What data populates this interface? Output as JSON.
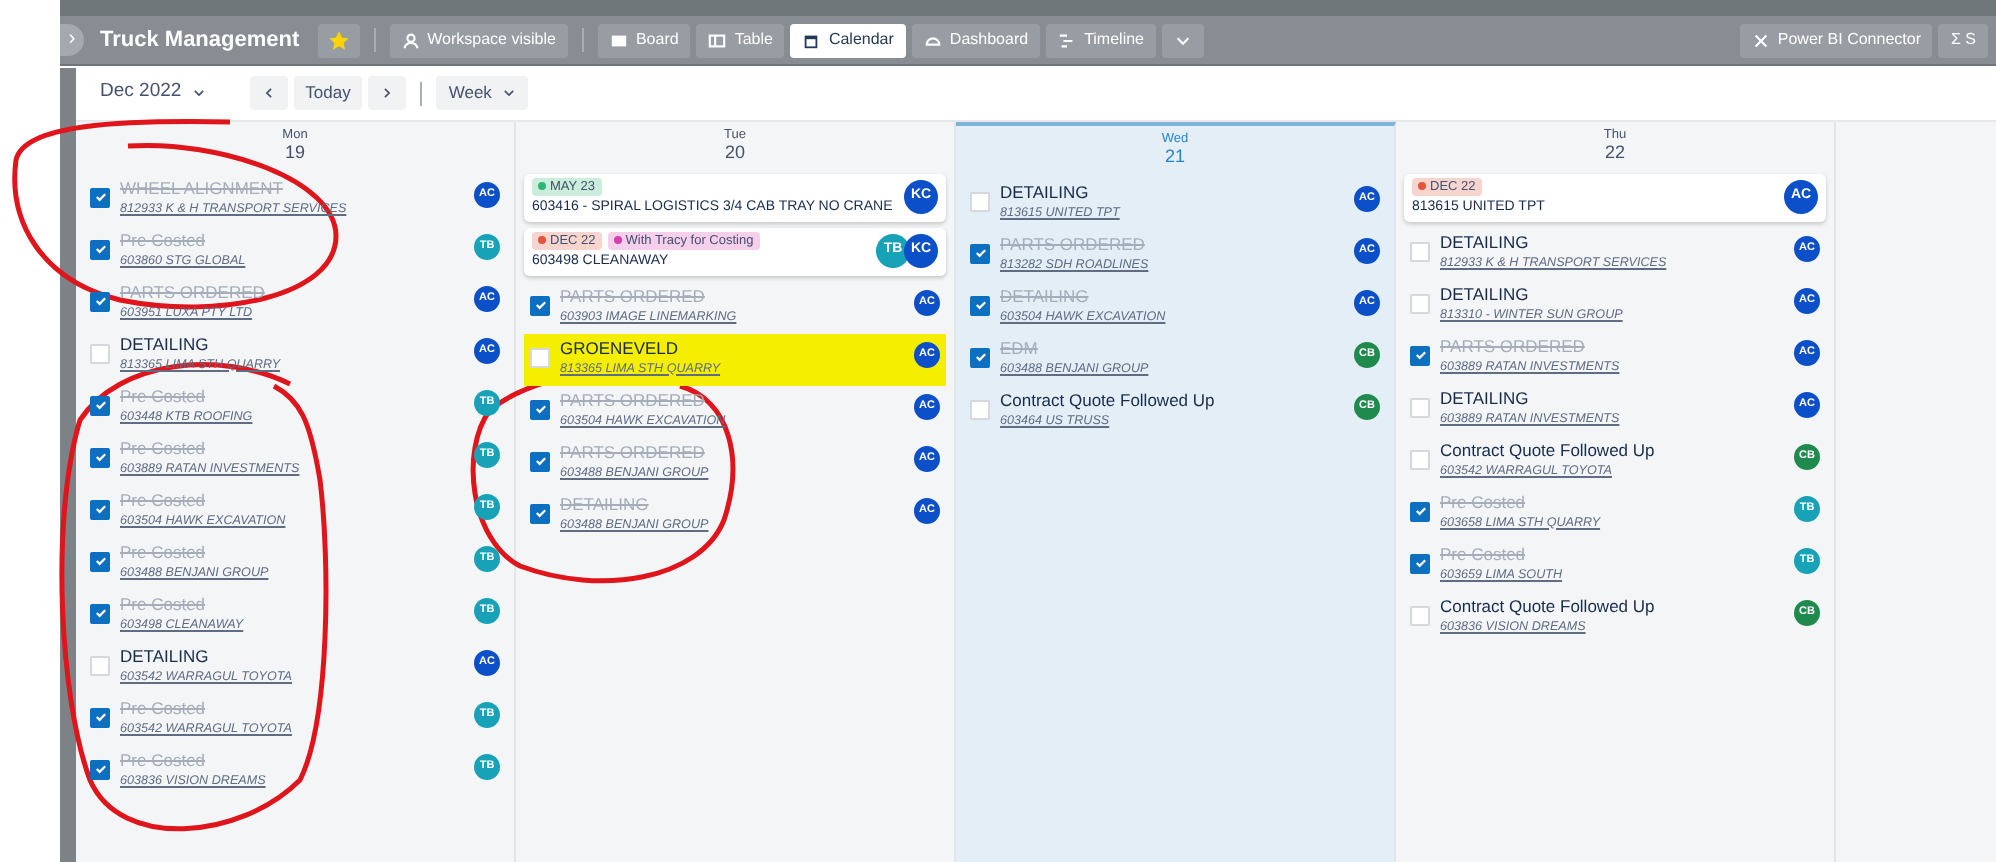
{
  "toolbar": {
    "collapse_glyph": "›",
    "board_title": "Truck Management",
    "favorite": true,
    "workspace": "Workspace visible",
    "views": [
      {
        "label": "Board",
        "selected": false
      },
      {
        "label": "Table",
        "selected": false
      },
      {
        "label": "Calendar",
        "selected": true
      },
      {
        "label": "Dashboard",
        "selected": false
      },
      {
        "label": "Timeline",
        "selected": false
      }
    ],
    "right_buttons": [
      "Power BI Connector",
      "Σ S"
    ]
  },
  "calendar_header": {
    "month": "Dec 2022",
    "today": "Today",
    "view": "Week"
  },
  "days": [
    {
      "weekday": "Mon",
      "date": "19",
      "selected": false,
      "items": [
        {
          "kind": "task",
          "checked": true,
          "title": "WHEEL ALIGNMENT",
          "subtitle": "812933 K & H TRANSPORT SERVICES",
          "assignees": [
            {
              "initials": "AC",
              "color": "#0b4fc9"
            }
          ]
        },
        {
          "kind": "task",
          "checked": true,
          "title": "Pre Costed",
          "subtitle": "603860 STG GLOBAL",
          "assignees": [
            {
              "initials": "TB",
              "color": "#17a2b8"
            }
          ]
        },
        {
          "kind": "task",
          "checked": true,
          "title": "PARTS ORDERED",
          "subtitle": "603951 LUXA PTY LTD",
          "assignees": [
            {
              "initials": "AC",
              "color": "#0b4fc9"
            }
          ]
        },
        {
          "kind": "task",
          "checked": false,
          "title": "DETAILING",
          "subtitle": "813365 LIMA STH QUARRY",
          "assignees": [
            {
              "initials": "AC",
              "color": "#0b4fc9"
            }
          ]
        },
        {
          "kind": "task",
          "checked": true,
          "title": "Pre Costed",
          "subtitle": "603448 KTB ROOFING",
          "assignees": [
            {
              "initials": "TB",
              "color": "#17a2b8"
            }
          ]
        },
        {
          "kind": "task",
          "checked": true,
          "title": "Pre Costed",
          "subtitle": "603889 RATAN INVESTMENTS",
          "assignees": [
            {
              "initials": "TB",
              "color": "#17a2b8"
            }
          ]
        },
        {
          "kind": "task",
          "checked": true,
          "title": "Pre Costed",
          "subtitle": "603504 HAWK EXCAVATION",
          "assignees": [
            {
              "initials": "TB",
              "color": "#17a2b8"
            }
          ]
        },
        {
          "kind": "task",
          "checked": true,
          "title": "Pre Costed",
          "subtitle": "603488 BENJANI GROUP",
          "assignees": [
            {
              "initials": "TB",
              "color": "#17a2b8"
            }
          ]
        },
        {
          "kind": "task",
          "checked": true,
          "title": "Pre Costed",
          "subtitle": "603498 CLEANAWAY",
          "assignees": [
            {
              "initials": "TB",
              "color": "#17a2b8"
            }
          ]
        },
        {
          "kind": "task",
          "checked": false,
          "title": "DETAILING",
          "subtitle": "603542 WARRAGUL TOYOTA",
          "assignees": [
            {
              "initials": "AC",
              "color": "#0b4fc9"
            }
          ]
        },
        {
          "kind": "task",
          "checked": true,
          "title": "Pre Costed",
          "subtitle": "603542 WARRAGUL TOYOTA",
          "assignees": [
            {
              "initials": "TB",
              "color": "#17a2b8"
            }
          ]
        },
        {
          "kind": "task",
          "checked": true,
          "title": "Pre Costed",
          "subtitle": "603836 VISION DREAMS",
          "assignees": [
            {
              "initials": "TB",
              "color": "#17a2b8"
            }
          ]
        }
      ]
    },
    {
      "weekday": "Tue",
      "date": "20",
      "selected": false,
      "items": [
        {
          "kind": "card",
          "tags": [
            {
              "label": "MAY 23",
              "color": "#2bb673"
            }
          ],
          "title": "603416 - SPIRAL LOGISTICS 3/4 CAB TRAY NO CRANE",
          "assignees": [
            {
              "initials": "KC",
              "color": "#0b4fc9"
            }
          ]
        },
        {
          "kind": "card",
          "tags": [
            {
              "label": "DEC 22",
              "color": "#e5533d"
            },
            {
              "label": "With Tracy for Costing",
              "color": "#d63fae"
            }
          ],
          "title": "603498 CLEANAWAY",
          "assignees": [
            {
              "initials": "TB",
              "color": "#17a2b8"
            },
            {
              "initials": "KC",
              "color": "#0b4fc9"
            }
          ]
        },
        {
          "kind": "task",
          "checked": true,
          "title": "PARTS ORDERED",
          "subtitle": "603903 IMAGE LINEMARKING",
          "assignees": [
            {
              "initials": "AC",
              "color": "#0b4fc9"
            }
          ]
        },
        {
          "kind": "task",
          "checked": false,
          "highlighted": true,
          "title": "GROENEVELD",
          "subtitle": "813365 LIMA STH QUARRY",
          "assignees": [
            {
              "initials": "AC",
              "color": "#0b4fc9"
            }
          ]
        },
        {
          "kind": "task",
          "checked": true,
          "title": "PARTS ORDERED",
          "subtitle": "603504 HAWK EXCAVATION",
          "assignees": [
            {
              "initials": "AC",
              "color": "#0b4fc9"
            }
          ]
        },
        {
          "kind": "task",
          "checked": true,
          "title": "PARTS ORDERED",
          "subtitle": "603488 BENJANI GROUP",
          "assignees": [
            {
              "initials": "AC",
              "color": "#0b4fc9"
            }
          ]
        },
        {
          "kind": "task",
          "checked": true,
          "title": "DETAILING",
          "subtitle": "603488 BENJANI GROUP",
          "assignees": [
            {
              "initials": "AC",
              "color": "#0b4fc9"
            }
          ]
        }
      ]
    },
    {
      "weekday": "Wed",
      "date": "21",
      "selected": true,
      "items": [
        {
          "kind": "task",
          "checked": false,
          "title": "DETAILING",
          "subtitle": "813615 UNITED TPT",
          "assignees": [
            {
              "initials": "AC",
              "color": "#0b4fc9"
            }
          ]
        },
        {
          "kind": "task",
          "checked": true,
          "title": "PARTS ORDERED",
          "subtitle": "813282 SDH ROADLINES",
          "assignees": [
            {
              "initials": "AC",
              "color": "#0b4fc9"
            }
          ]
        },
        {
          "kind": "task",
          "checked": true,
          "title": "DETAILING",
          "subtitle": "603504 HAWK EXCAVATION",
          "assignees": [
            {
              "initials": "AC",
              "color": "#0b4fc9"
            }
          ]
        },
        {
          "kind": "task",
          "checked": true,
          "title": "EDM",
          "subtitle": "603488 BENJANI GROUP",
          "assignees": [
            {
              "initials": "CB",
              "color": "#1e8a4e"
            }
          ]
        },
        {
          "kind": "task",
          "checked": false,
          "title": "Contract Quote Followed Up",
          "subtitle": "603464 US TRUSS",
          "assignees": [
            {
              "initials": "CB",
              "color": "#1e8a4e"
            }
          ]
        }
      ]
    },
    {
      "weekday": "Thu",
      "date": "22",
      "selected": false,
      "items": [
        {
          "kind": "card",
          "tags": [
            {
              "label": "DEC 22",
              "color": "#e5533d"
            }
          ],
          "title": "813615 UNITED TPT",
          "assignees": [
            {
              "initials": "AC",
              "color": "#0b4fc9"
            }
          ]
        },
        {
          "kind": "task",
          "checked": false,
          "title": "DETAILING",
          "subtitle": "812933 K & H TRANSPORT SERVICES",
          "assignees": [
            {
              "initials": "AC",
              "color": "#0b4fc9"
            }
          ]
        },
        {
          "kind": "task",
          "checked": false,
          "title": "DETAILING",
          "subtitle": "813310 - WINTER SUN GROUP",
          "assignees": [
            {
              "initials": "AC",
              "color": "#0b4fc9"
            }
          ]
        },
        {
          "kind": "task",
          "checked": true,
          "title": "PARTS ORDERED",
          "subtitle": "603889 RATAN INVESTMENTS",
          "assignees": [
            {
              "initials": "AC",
              "color": "#0b4fc9"
            }
          ]
        },
        {
          "kind": "task",
          "checked": false,
          "title": "DETAILING",
          "subtitle": "603889 RATAN INVESTMENTS",
          "assignees": [
            {
              "initials": "AC",
              "color": "#0b4fc9"
            }
          ]
        },
        {
          "kind": "task",
          "checked": false,
          "title": "Contract Quote Followed Up",
          "subtitle": "603542 WARRAGUL TOYOTA",
          "assignees": [
            {
              "initials": "CB",
              "color": "#1e8a4e"
            }
          ]
        },
        {
          "kind": "task",
          "checked": true,
          "title": "Pre Costed",
          "subtitle": "603658 LIMA STH QUARRY",
          "assignees": [
            {
              "initials": "TB",
              "color": "#17a2b8"
            }
          ]
        },
        {
          "kind": "task",
          "checked": true,
          "title": "Pre Costed",
          "subtitle": "603659 LIMA SOUTH",
          "assignees": [
            {
              "initials": "TB",
              "color": "#17a2b8"
            }
          ]
        },
        {
          "kind": "task",
          "checked": false,
          "title": "Contract Quote Followed Up",
          "subtitle": "603836 VISION DREAMS",
          "assignees": [
            {
              "initials": "CB",
              "color": "#1e8a4e"
            }
          ]
        }
      ]
    }
  ]
}
